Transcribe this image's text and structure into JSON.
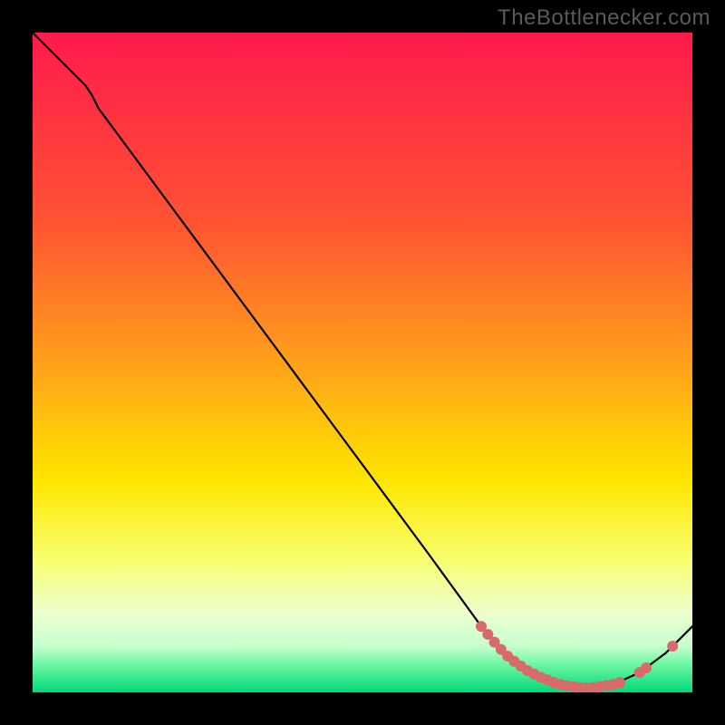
{
  "credit": "TheBottlenecker.com",
  "chart_data": {
    "type": "line",
    "title": "",
    "xlabel": "",
    "ylabel": "",
    "xlim": [
      0,
      100
    ],
    "ylim": [
      0,
      100
    ],
    "gradient_stops": [
      {
        "offset": 0,
        "color": "#ff1a4d"
      },
      {
        "offset": 28,
        "color": "#ff5133"
      },
      {
        "offset": 50,
        "color": "#ffa01a"
      },
      {
        "offset": 68,
        "color": "#ffe600"
      },
      {
        "offset": 80,
        "color": "#f8ff70"
      },
      {
        "offset": 88,
        "color": "#ecffcf"
      },
      {
        "offset": 93,
        "color": "#c7ffcf"
      },
      {
        "offset": 96,
        "color": "#66f59e"
      },
      {
        "offset": 100,
        "color": "#00d97a"
      }
    ],
    "series": [
      {
        "name": "curve",
        "type": "line",
        "color": "#000000",
        "points": [
          {
            "x": 0,
            "y": 100
          },
          {
            "x": 4,
            "y": 96
          },
          {
            "x": 8,
            "y": 92
          },
          {
            "x": 9,
            "y": 90.5
          },
          {
            "x": 10,
            "y": 88.5
          },
          {
            "x": 20,
            "y": 75
          },
          {
            "x": 30,
            "y": 61.5
          },
          {
            "x": 40,
            "y": 48
          },
          {
            "x": 50,
            "y": 34.5
          },
          {
            "x": 60,
            "y": 21
          },
          {
            "x": 68,
            "y": 10
          },
          {
            "x": 72,
            "y": 5.5
          },
          {
            "x": 76,
            "y": 2.8
          },
          {
            "x": 80,
            "y": 1.2
          },
          {
            "x": 84,
            "y": 0.7
          },
          {
            "x": 88,
            "y": 1.2
          },
          {
            "x": 92,
            "y": 3.0
          },
          {
            "x": 96,
            "y": 6.0
          },
          {
            "x": 100,
            "y": 10
          }
        ]
      },
      {
        "name": "markers",
        "type": "scatter",
        "color": "#d86a6a",
        "radius": 6,
        "points": [
          {
            "x": 68,
            "y": 10
          },
          {
            "x": 69,
            "y": 8.8
          },
          {
            "x": 70,
            "y": 7.6
          },
          {
            "x": 71,
            "y": 6.5
          },
          {
            "x": 72,
            "y": 5.5
          },
          {
            "x": 73,
            "y": 4.7
          },
          {
            "x": 74,
            "y": 4.0
          },
          {
            "x": 75,
            "y": 3.3
          },
          {
            "x": 76,
            "y": 2.8
          },
          {
            "x": 77,
            "y": 2.3
          },
          {
            "x": 78,
            "y": 1.9
          },
          {
            "x": 79,
            "y": 1.5
          },
          {
            "x": 80,
            "y": 1.2
          },
          {
            "x": 81,
            "y": 1.0
          },
          {
            "x": 82,
            "y": 0.85
          },
          {
            "x": 83,
            "y": 0.75
          },
          {
            "x": 84,
            "y": 0.7
          },
          {
            "x": 85,
            "y": 0.75
          },
          {
            "x": 86,
            "y": 0.9
          },
          {
            "x": 87,
            "y": 1.05
          },
          {
            "x": 88,
            "y": 1.2
          },
          {
            "x": 89,
            "y": 1.5
          },
          {
            "x": 92,
            "y": 3.0
          },
          {
            "x": 93,
            "y": 3.7
          },
          {
            "x": 97,
            "y": 7.0
          }
        ]
      }
    ]
  }
}
